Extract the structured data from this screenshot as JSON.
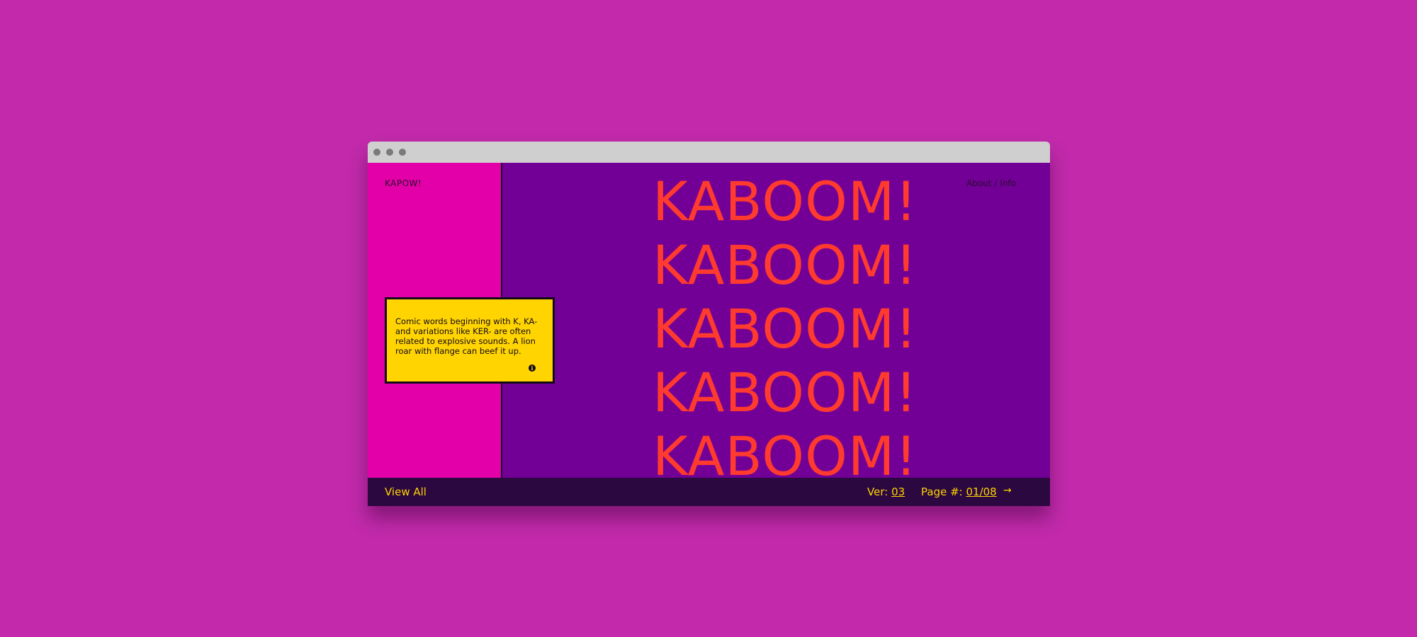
{
  "brand": "KAPOW!",
  "nav": {
    "about_info": "About / Info"
  },
  "info_card": {
    "text": "Comic words beginning with K, KA- and variations like KER- are often related to explosive sounds. A lion roar with flange can beef it up.",
    "icon": "i"
  },
  "hero_words": [
    "KABOOM!",
    "KABOOM!",
    "KABOOM!",
    "KABOOM!",
    "KABOOM!"
  ],
  "footer": {
    "view_all": "View All",
    "ver_label": "Ver:",
    "ver_value": "03",
    "page_label": "Page #:",
    "page_value": "01/08",
    "next_arrow": "→"
  },
  "colors": {
    "page_bg": "#c22aab",
    "left_panel": "#e400a8",
    "main_bg": "#720096",
    "accent_yellow": "#ffd400",
    "hero_red": "#ff3a2e",
    "footer_bg": "#2b0840"
  }
}
